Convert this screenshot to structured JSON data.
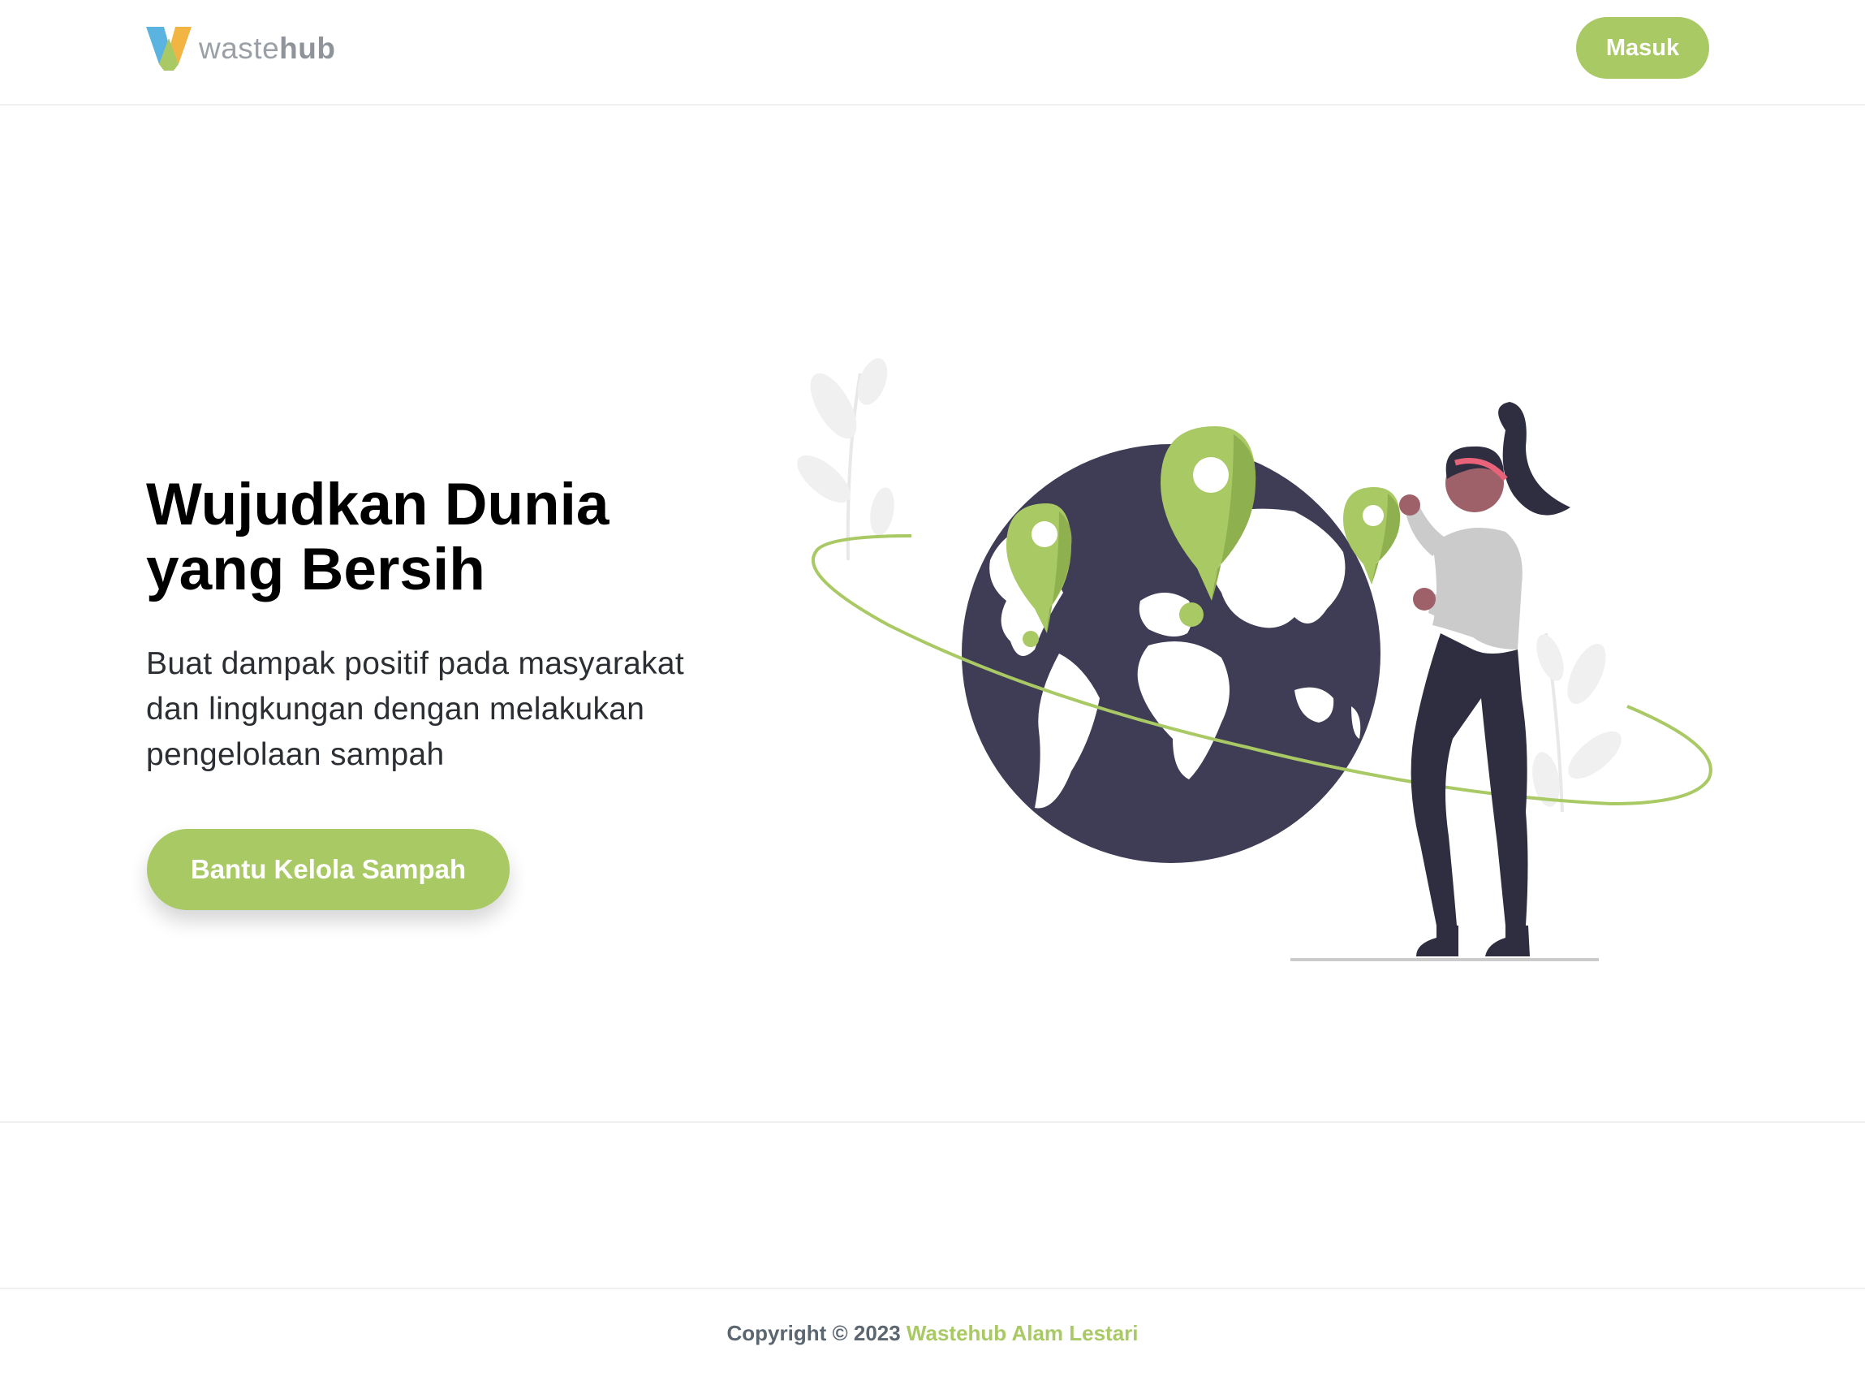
{
  "header": {
    "logo": {
      "text_light": "waste",
      "text_bold": "hub",
      "icon": "wastehub-logo-icon"
    },
    "login_label": "Masuk"
  },
  "hero": {
    "title_line1": "Wujudkan Dunia",
    "title_line2": "yang Bersih",
    "subtitle_line1": "Buat dampak positif pada masyarakat",
    "subtitle_line2": "dan lingkungan dengan melakukan",
    "subtitle_line3": "pengelolaan sampah",
    "cta_label": "Bantu Kelola Sampah",
    "illustration": "woman-pinning-locations-on-globe-illustration"
  },
  "footer": {
    "copyright": "Copyright © 2023 ",
    "brand": "Wastehub Alam Lestari"
  },
  "colors": {
    "accent": "#a8c963",
    "globe": "#3f3d56",
    "text_dark": "#000000",
    "footer_text": "#5b6670"
  }
}
